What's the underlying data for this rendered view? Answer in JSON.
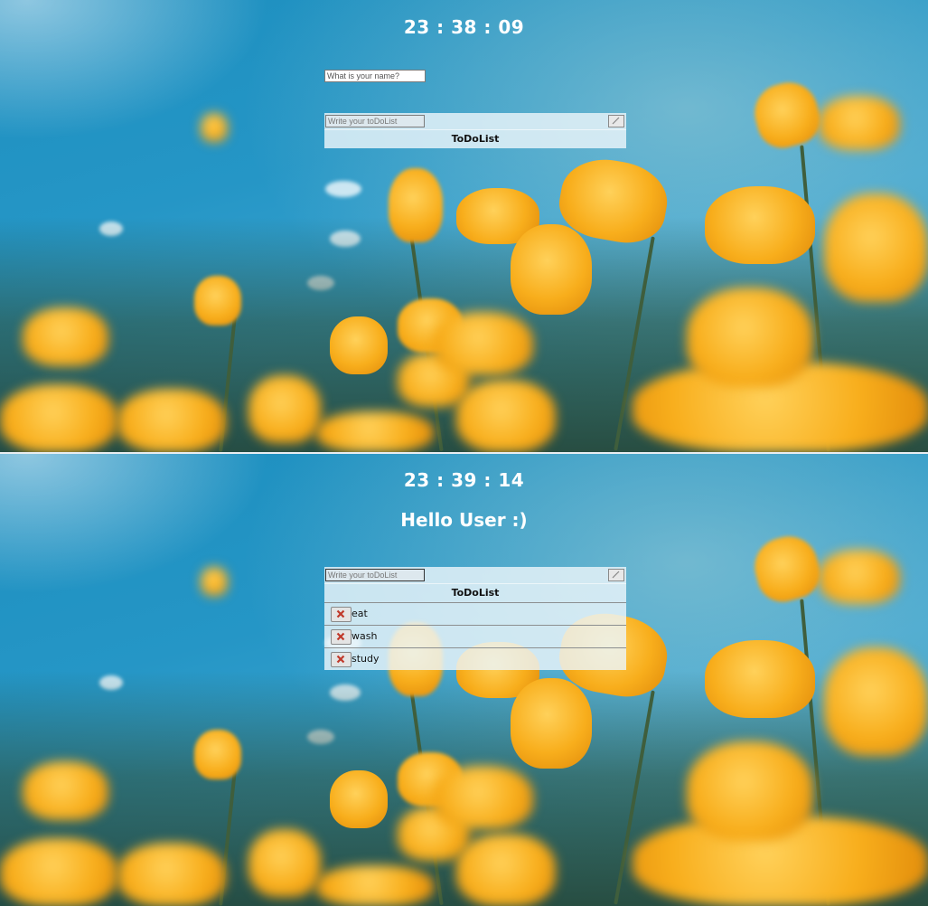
{
  "panels": {
    "top": {
      "clock": "23 : 38 : 09",
      "name_input": {
        "placeholder": "What is your name?"
      },
      "todo": {
        "input_placeholder": "Write your toDoList",
        "heading": "ToDoList",
        "items": []
      }
    },
    "bottom": {
      "clock": "23 : 39 : 14",
      "greeting": "Hello User :)",
      "todo": {
        "input_placeholder": "Write your toDoList",
        "heading": "ToDoList",
        "items": [
          {
            "text": "eat"
          },
          {
            "text": "wash"
          },
          {
            "text": "study"
          }
        ]
      }
    }
  },
  "icons": {
    "submit": "pencil-icon",
    "delete": "red-x-icon"
  },
  "colors": {
    "delete_x": "#c0392b",
    "sky": "#2596c6",
    "flower": "#f8ae1c"
  }
}
